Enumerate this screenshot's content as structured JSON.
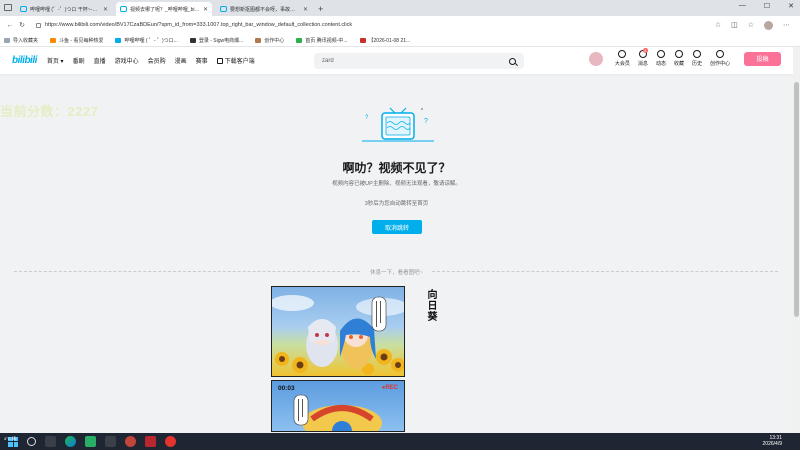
{
  "browser": {
    "tabs": [
      {
        "title": "哔哩哔哩 (゜-゜)つロ 干杯~-bilibili",
        "active": false
      },
      {
        "title": "视频去哪了呢？_哔哩哔哩_bilibili",
        "active": true
      },
      {
        "title": "要想新抠图都不会呀，事故全是她...",
        "active": false
      }
    ],
    "new_tab": "+",
    "window_controls": {
      "minimize": "—",
      "maximize": "☐",
      "close": "✕"
    },
    "address": {
      "url": "https://www.bilibili.com/video/BV17CzaBDEun/?spm_id_from=333.1007.top_right_bar_window_default_collection.content.click",
      "back": "←",
      "reload": "↻",
      "star": "☆",
      "more": "⋯"
    },
    "bookmarks": [
      {
        "label": "导入收藏夹"
      },
      {
        "label": "斗鱼 - 看见每种热爱"
      },
      {
        "label": "哔哩哔哩 ( ゜- ゜)つロ..."
      },
      {
        "label": "登录 - Sigw电商爆..."
      },
      {
        "label": "创作中心"
      },
      {
        "label": "首页 腾讯视频-中..."
      },
      {
        "label": "【2026-01-08 21..."
      }
    ]
  },
  "bili_header": {
    "logo": "bilibili",
    "nav": [
      {
        "label": "首页 ▾"
      },
      {
        "label": "番剧"
      },
      {
        "label": "直播"
      },
      {
        "label": "游戏中心"
      },
      {
        "label": "会员购"
      },
      {
        "label": "漫画"
      },
      {
        "label": "赛事"
      },
      {
        "label": "下载客户端"
      }
    ],
    "search": {
      "value": "zard",
      "placeholder": ""
    },
    "right_items": [
      {
        "label": "大会员",
        "icon": "member-icon",
        "badge": ""
      },
      {
        "label": "消息",
        "icon": "message-icon",
        "badge": "8"
      },
      {
        "label": "动态",
        "icon": "dynamic-icon",
        "badge": ""
      },
      {
        "label": "收藏",
        "icon": "favorite-icon",
        "badge": ""
      },
      {
        "label": "历史",
        "icon": "history-icon",
        "badge": ""
      },
      {
        "label": "创作中心",
        "icon": "creator-icon",
        "badge": ""
      }
    ],
    "upload": "投稿"
  },
  "overlay_score": "当前分数：2227",
  "main": {
    "title": "啊叻？视频不见了？",
    "subtitle": "视频内容已被UP主删除、视频无法观看，敬请谅解。",
    "redirect": "3秒后为您自动跳转至首页",
    "cancel_button": "取消跳转",
    "divider": "休息一下，看看图吧~",
    "comic_title": "向日葵",
    "comic_rec_time": "00:03",
    "comic_rec_label": "●REC"
  },
  "taskbar": {
    "time": "13:31",
    "date": "2026/4/9",
    "weather": "4°C 晴"
  },
  "colors": {
    "accent": "#00aeec",
    "pink": "#fb7299",
    "score_overlay": "#e5edc4",
    "taskbar": "#1f2633"
  }
}
